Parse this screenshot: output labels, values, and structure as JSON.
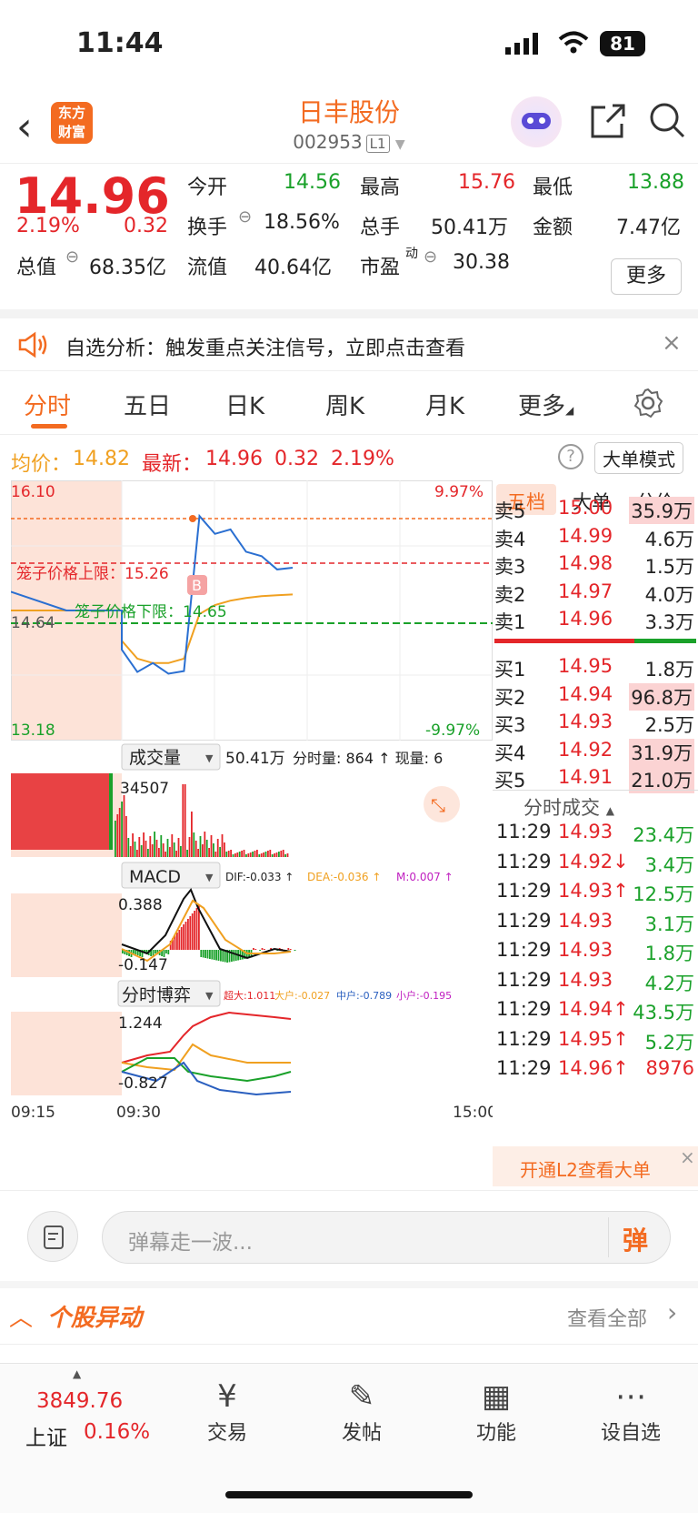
{
  "status": {
    "time": "11:44",
    "battery": "81"
  },
  "header": {
    "back_icon": "chevron-left-icon",
    "logo": "东方\n财富",
    "logo_line1": "东方",
    "logo_line2": "财富",
    "title": "日丰股份",
    "code": "002953",
    "level": "L1"
  },
  "quote": {
    "price": "14.96",
    "change_pct": "2.19%",
    "change": "0.32",
    "open_label": "今开",
    "open": "14.56",
    "high_label": "最高",
    "high": "15.76",
    "low_label": "最低",
    "low": "13.88",
    "turnover_label": "换手",
    "turnover": "18.56%",
    "volume_label": "总手",
    "volume": "50.41万",
    "amount_label": "金额",
    "amount": "7.47亿",
    "mktcap_label": "总值",
    "mktcap": "68.35亿",
    "float_label": "流值",
    "float": "40.64亿",
    "pe_label": "市盈",
    "pe_sup": "动",
    "pe": "30.38",
    "more": "更多"
  },
  "banner": {
    "text": "自选分析：触发重点关注信号，立即点击查看"
  },
  "tabs": [
    "分时",
    "五日",
    "日K",
    "周K",
    "月K",
    "更多"
  ],
  "info": {
    "avg_label": "均价：",
    "avg": "14.82",
    "latest_label": "最新：",
    "latest": "14.96",
    "chg": "0.32",
    "pct": "2.19%",
    "mode": "大单模式"
  },
  "chart": {
    "top_price": "16.10",
    "top_pct": "9.97%",
    "bottom_price": "13.18",
    "bottom_pct": "-9.97%",
    "mid_price": "14.64",
    "upper_limit": "笼子价格上限：15.26",
    "lower_limit": "笼子价格下限：14.65",
    "buy_marker": "B",
    "vol_label": "成交量",
    "vol_info": "50.41万",
    "vol_detail": "分时量: 864 ↑ 现量: 6",
    "vol_max": "34507",
    "macd_label": "MACD",
    "dif": "DIF:-0.033 ↑",
    "dea": "DEA:-0.036 ↑",
    "m": "M:0.007 ↑",
    "macd_top": "0.388",
    "macd_bottom": "-0.147",
    "game_label": "分时博弈",
    "super": "超大:1.011",
    "big": "大户:-0.027",
    "mid": "中户:-0.789",
    "small": "小户:-0.195",
    "game_top": "1.244",
    "game_bottom": "-0.827",
    "t_start": "09:15",
    "t_open": "09:30",
    "t_end": "15:00"
  },
  "chart_data": {
    "type": "line",
    "title": "",
    "ylim": [
      13.18,
      16.1
    ],
    "series": [
      {
        "name": "",
        "values": [
          14.85,
          14.64,
          14.64,
          14.2,
          13.95,
          14.05,
          13.93,
          13.96,
          15.7,
          15.5,
          15.55,
          15.3,
          15.25,
          15.1,
          15.12
        ]
      },
      {
        "name": "均价",
        "values": [
          14.64,
          14.64,
          14.64,
          14.3,
          14.1,
          14.05,
          14.05,
          14.1,
          14.6,
          14.7,
          14.75,
          14.78,
          14.8,
          14.81,
          14.82
        ]
      }
    ]
  },
  "panel": {
    "tabs": [
      "五档",
      "大单",
      "分价"
    ],
    "asks": [
      {
        "label": "卖5",
        "price": "15.00",
        "vol": "35.9万"
      },
      {
        "label": "卖4",
        "price": "14.99",
        "vol": "4.6万"
      },
      {
        "label": "卖3",
        "price": "14.98",
        "vol": "1.5万"
      },
      {
        "label": "卖2",
        "price": "14.97",
        "vol": "4.0万"
      },
      {
        "label": "卖1",
        "price": "14.96",
        "vol": "3.3万"
      }
    ],
    "bids": [
      {
        "label": "买1",
        "price": "14.95",
        "vol": "1.8万"
      },
      {
        "label": "买2",
        "price": "14.94",
        "vol": "96.8万"
      },
      {
        "label": "买3",
        "price": "14.93",
        "vol": "2.5万"
      },
      {
        "label": "买4",
        "price": "14.92",
        "vol": "31.9万"
      },
      {
        "label": "买5",
        "price": "14.91",
        "vol": "21.0万"
      }
    ],
    "ticks_title": "分时成交",
    "ticks": [
      {
        "t": "11:29",
        "p": "14.93",
        "v": "23.4万"
      },
      {
        "t": "11:29",
        "p": "14.92↓",
        "v": "3.4万"
      },
      {
        "t": "11:29",
        "p": "14.93↑",
        "v": "12.5万"
      },
      {
        "t": "11:29",
        "p": "14.93",
        "v": "3.1万"
      },
      {
        "t": "11:29",
        "p": "14.93",
        "v": "1.8万"
      },
      {
        "t": "11:29",
        "p": "14.93",
        "v": "4.2万"
      },
      {
        "t": "11:29",
        "p": "14.94↑",
        "v": "43.5万"
      },
      {
        "t": "11:29",
        "p": "14.95↑",
        "v": "5.2万"
      },
      {
        "t": "11:29",
        "p": "14.96↑",
        "v": "8976"
      }
    ],
    "l2": "开通L2查看大单"
  },
  "comment": {
    "placeholder": "弹幕走一波...",
    "btn": "弹"
  },
  "section": {
    "title": "个股异动",
    "more": "查看全部"
  },
  "bottom_nav": {
    "index_value": "3849.76",
    "index_name": "上证",
    "index_pct": "0.16%",
    "items": [
      {
        "label": "交易",
        "icon": "¥"
      },
      {
        "label": "发帖",
        "icon": "✎"
      },
      {
        "label": "功能",
        "icon": "▦"
      },
      {
        "label": "设自选",
        "icon": "⋯"
      }
    ]
  }
}
